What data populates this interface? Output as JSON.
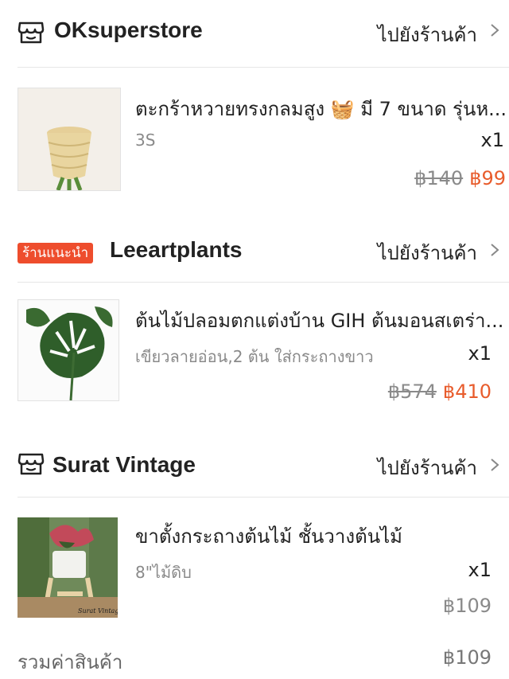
{
  "shops": [
    {
      "name": "OKsuperstore",
      "badge": null,
      "goto_label": "ไปยังร้านค้า",
      "item": {
        "title": "ตะกร้าหวายทรงกลมสูง 🧺 มี 7 ขนาด รุ่นห...",
        "variant": "3S",
        "qty": "x1",
        "old_price": "฿140",
        "price": "฿99"
      }
    },
    {
      "name": "Leeartplants",
      "badge": "ร้านแนะนำ",
      "goto_label": "ไปยังร้านค้า",
      "item": {
        "title": "ต้นไม้ปลอมตกแต่งบ้าน GIH ต้นมอนสเตร่า...",
        "variant": "เขียวลายอ่อน,2 ต้น ใส่กระถางขาว",
        "qty": "x1",
        "old_price": "฿574",
        "price": "฿410"
      }
    },
    {
      "name": "Surat Vintage",
      "badge": null,
      "goto_label": "ไปยังร้านค้า",
      "item": {
        "title": "ขาตั้งกระถางต้นไม้ ชั้นวางต้นไม้",
        "variant": "8\"ไม้ดิบ",
        "qty": "x1",
        "price": "฿109",
        "image_caption": "Surat Vintage"
      }
    }
  ],
  "summary": {
    "label": "รวมค่าสินค้า",
    "value": "฿109"
  },
  "colors": {
    "accent": "#ee4d2d",
    "sale_price": "#e85c2c",
    "muted": "#8a8a8a"
  },
  "icons": [
    "shop-icon",
    "chevron-right-icon"
  ]
}
